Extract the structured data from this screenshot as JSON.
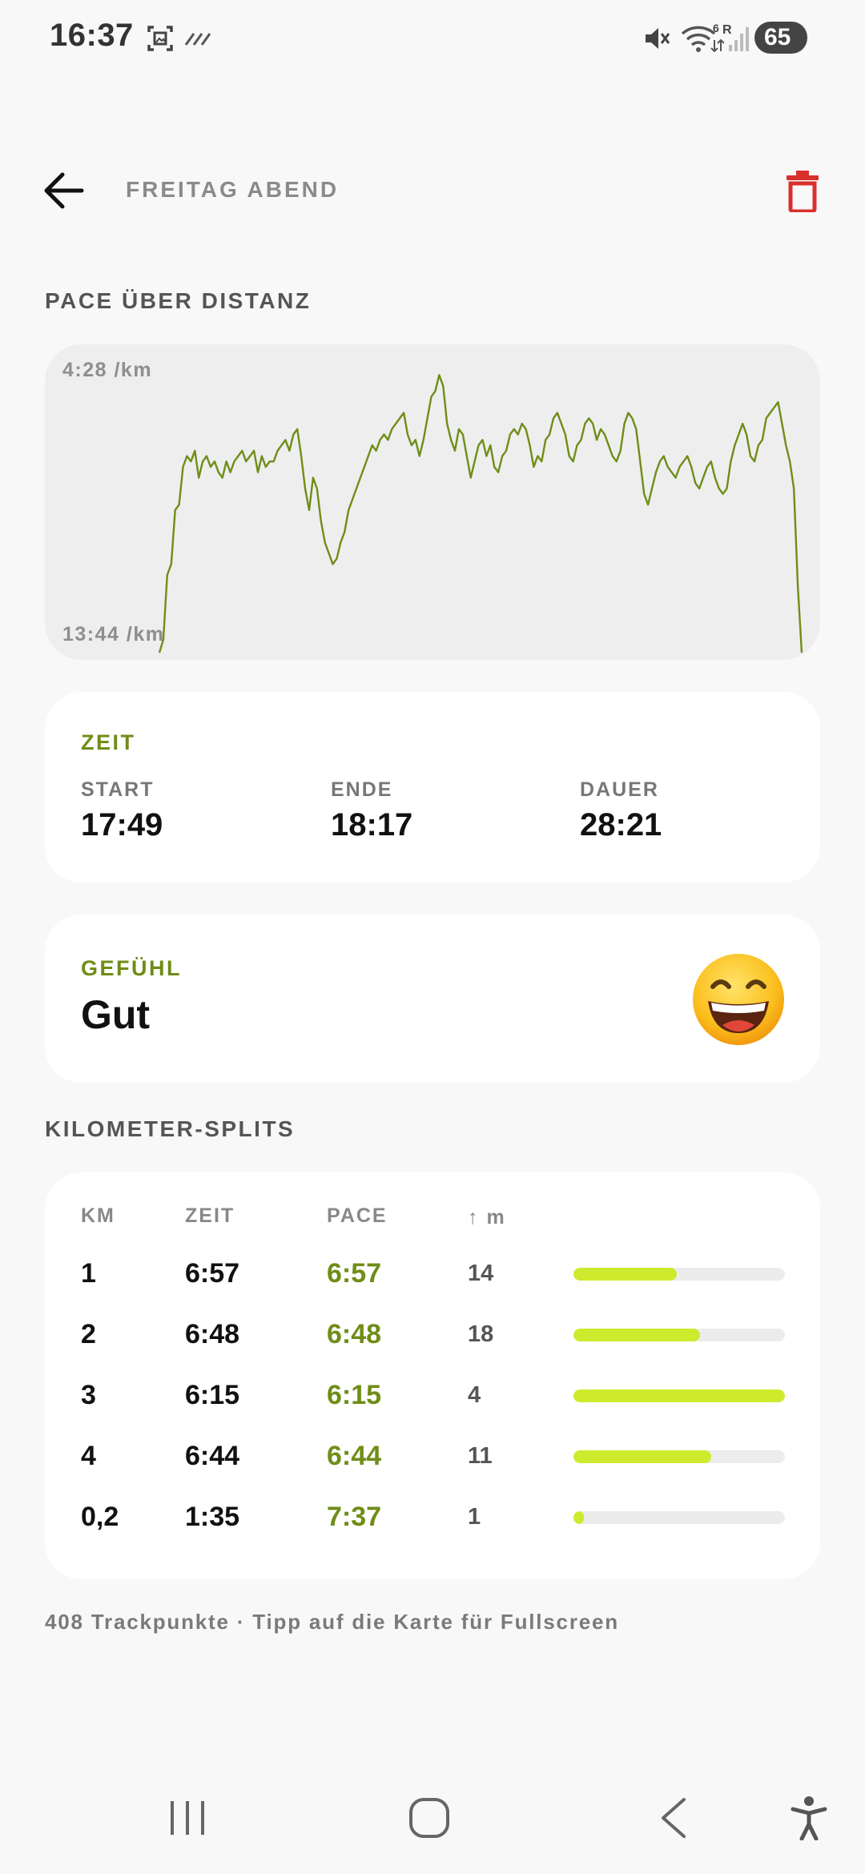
{
  "status_bar": {
    "time": "16:37",
    "battery": "65",
    "icons": [
      "screenshot-icon",
      "data-saver-icon",
      "mute-icon",
      "wifi-icon",
      "signal-icon",
      "battery-icon"
    ]
  },
  "header": {
    "title": "FREITAG ABEND",
    "back_icon": "arrow-left-icon",
    "delete_icon": "trash-icon",
    "delete_color": "#d9302c"
  },
  "pace_section": {
    "title": "PACE ÜBER DISTANZ",
    "top_label": "4:28 /km",
    "bottom_label": "13:44 /km"
  },
  "chart_data": {
    "type": "line",
    "ylabel": "",
    "xlabel": "",
    "line_color": "#6f8d17",
    "y_top_label": "4:28 /km",
    "y_bottom_label": "13:44 /km",
    "ylim_seconds_per_km": [
      268,
      824
    ],
    "series": [
      {
        "values": [
          824,
          800,
          680,
          660,
          560,
          550,
          480,
          460,
          470,
          450,
          500,
          470,
          460,
          480,
          470,
          490,
          500,
          470,
          490,
          470,
          460,
          450,
          470,
          460,
          450,
          490,
          460,
          480,
          470,
          470,
          450,
          440,
          430,
          450,
          420,
          410,
          460,
          520,
          560,
          500,
          520,
          580,
          620,
          640,
          660,
          650,
          620,
          600,
          560,
          540,
          520,
          500,
          480,
          460,
          440,
          450,
          430,
          420,
          430,
          410,
          400,
          390,
          380,
          420,
          440,
          430,
          460,
          430,
          390,
          350,
          340,
          310,
          330,
          400,
          430,
          450,
          410,
          420,
          460,
          500,
          470,
          440,
          430,
          460,
          440,
          480,
          490,
          460,
          450,
          420,
          410,
          420,
          400,
          410,
          440,
          480,
          460,
          470,
          430,
          420,
          390,
          380,
          400,
          420,
          460,
          470,
          440,
          430,
          400,
          390,
          400,
          430,
          410,
          420,
          440,
          460,
          470,
          450,
          400,
          380,
          390,
          410,
          470,
          530,
          550,
          520,
          490,
          470,
          460,
          480,
          490,
          500,
          480,
          470,
          460,
          480,
          510,
          520,
          500,
          480,
          470,
          500,
          520,
          530,
          520,
          470,
          440,
          420,
          400,
          420,
          460,
          470,
          440,
          430,
          390,
          380,
          370,
          360,
          400,
          440,
          470,
          520,
          700,
          824
        ]
      }
    ]
  },
  "zeit_card": {
    "label": "ZEIT",
    "start_label": "START",
    "start_value": "17:49",
    "ende_label": "ENDE",
    "ende_value": "18:17",
    "dauer_label": "DAUER",
    "dauer_value": "28:21"
  },
  "gefuehl_card": {
    "label": "GEFÜHL",
    "value": "Gut",
    "emoji": "😄"
  },
  "splits": {
    "title": "KILOMETER-SPLITS",
    "headers": {
      "km": "KM",
      "zeit": "ZEIT",
      "pace": "PACE",
      "elev": "↑ m"
    },
    "rows": [
      {
        "km": "1",
        "zeit": "6:57",
        "pace": "6:57",
        "elev": "14",
        "fill": 0.49
      },
      {
        "km": "2",
        "zeit": "6:48",
        "pace": "6:48",
        "elev": "18",
        "fill": 0.6
      },
      {
        "km": "3",
        "zeit": "6:15",
        "pace": "6:15",
        "elev": "4",
        "fill": 1.0
      },
      {
        "km": "4",
        "zeit": "6:44",
        "pace": "6:44",
        "elev": "11",
        "fill": 0.65
      },
      {
        "km": "0,2",
        "zeit": "1:35",
        "pace": "7:37",
        "elev": "1",
        "fill": 0.05
      }
    ],
    "bar_color": "#cdeb2c"
  },
  "footer": {
    "note": "408 Trackpunkte · Tipp auf die Karte für Fullscreen"
  },
  "navbar": {
    "items": [
      "recents-icon",
      "home-icon",
      "back-icon",
      "accessibility-icon"
    ]
  }
}
